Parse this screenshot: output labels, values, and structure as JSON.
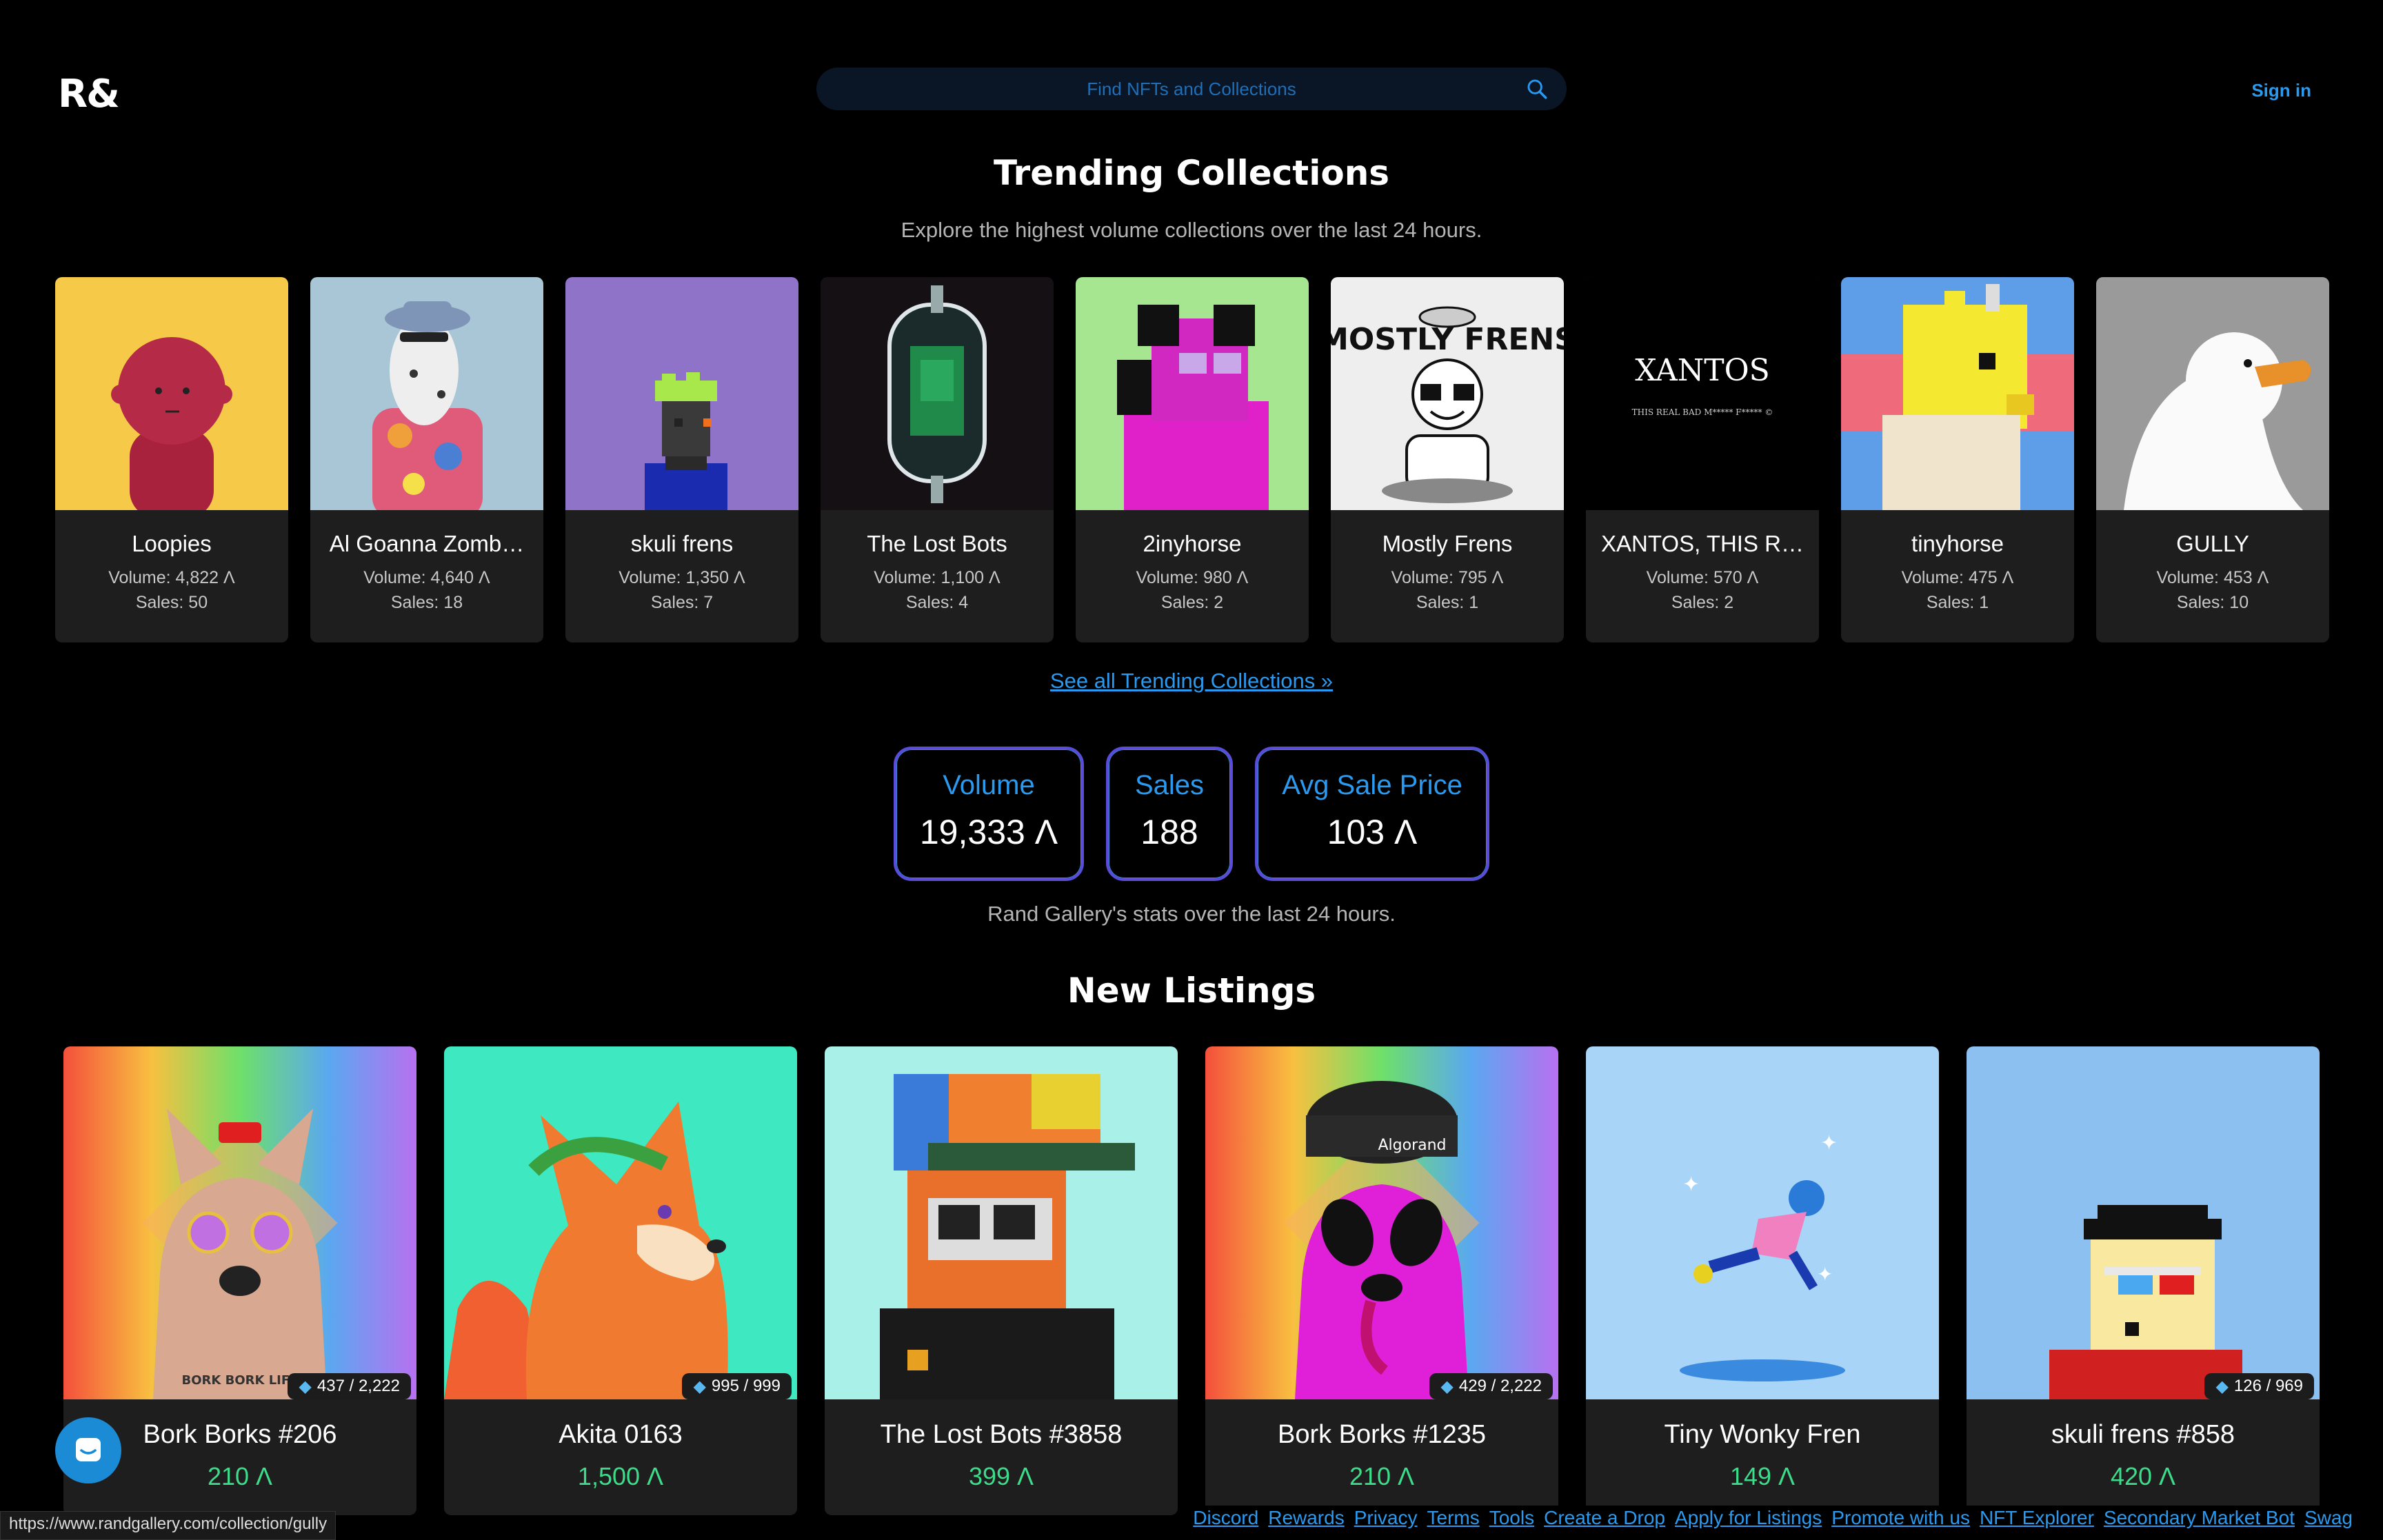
{
  "header": {
    "logo": "R&",
    "search_placeholder": "Find NFTs and Collections",
    "sign_in": "Sign in"
  },
  "trending": {
    "title": "Trending Collections",
    "subtitle": "Explore the highest volume collections over the last 24 hours.",
    "see_all": "See all Trending Collections »",
    "items": [
      {
        "name": "Loopies",
        "volume": "Volume: 4,822 Ʌ",
        "sales": "Sales: 50"
      },
      {
        "name": "Al Goanna Zomb…",
        "volume": "Volume: 4,640 Ʌ",
        "sales": "Sales: 18"
      },
      {
        "name": "skuli frens",
        "volume": "Volume: 1,350 Ʌ",
        "sales": "Sales: 7"
      },
      {
        "name": "The Lost Bots",
        "volume": "Volume: 1,100 Ʌ",
        "sales": "Sales: 4"
      },
      {
        "name": "2inyhorse",
        "volume": "Volume: 980 Ʌ",
        "sales": "Sales: 2"
      },
      {
        "name": "Mostly Frens",
        "volume": "Volume: 795 Ʌ",
        "sales": "Sales: 1"
      },
      {
        "name": "XANTOS, THIS R…",
        "volume": "Volume: 570 Ʌ",
        "sales": "Sales: 2"
      },
      {
        "name": "tinyhorse",
        "volume": "Volume: 475 Ʌ",
        "sales": "Sales: 1"
      },
      {
        "name": "GULLY",
        "volume": "Volume: 453 Ʌ",
        "sales": "Sales: 10"
      }
    ],
    "mostly_frens_art_text": "MOSTLY FRENS",
    "xantos_art_text": "XANTOS",
    "xantos_art_subtext": "THIS REAL BAD M***** F***** ©"
  },
  "stats": {
    "volume_label": "Volume",
    "volume_value": "19,333 Ʌ",
    "sales_label": "Sales",
    "sales_value": "188",
    "avg_label": "Avg Sale Price",
    "avg_value": "103 Ʌ",
    "caption": "Rand Gallery's stats over the last 24 hours."
  },
  "listings": {
    "title": "New Listings",
    "items": [
      {
        "name": "Bork Borks #206",
        "price": "210 Ʌ",
        "rank": "437 / 2,222"
      },
      {
        "name": "Akita 0163",
        "price": "1,500 Ʌ",
        "rank": "995 / 999"
      },
      {
        "name": "The Lost Bots #3858",
        "price": "399 Ʌ",
        "rank": ""
      },
      {
        "name": "Bork Borks #1235",
        "price": "210 Ʌ",
        "rank": "429 / 2,222"
      },
      {
        "name": "Tiny Wonky Fren",
        "price": "149 Ʌ",
        "rank": ""
      },
      {
        "name": "skuli frens #858",
        "price": "420 Ʌ",
        "rank": "126 / 969"
      }
    ],
    "bork_tattoo_text": "BORK BORK LIFE",
    "algorand_cap_text": "Algorand"
  },
  "footer": {
    "links": [
      "Discord",
      "Rewards",
      "Privacy",
      "Terms",
      "Tools",
      "Create a Drop",
      "Apply for Listings",
      "Promote with us",
      "NFT Explorer",
      "Secondary Market Bot",
      "Swag"
    ]
  },
  "status_url": "https://www.randgallery.com/collection/gully",
  "icons": {
    "search": "search-icon",
    "chat": "chat-bubble-icon",
    "rank": "diamond-icon"
  },
  "colors": {
    "accent": "#2a9af0",
    "price": "#3ddc8a",
    "stat_border": "#5a4bd8"
  }
}
